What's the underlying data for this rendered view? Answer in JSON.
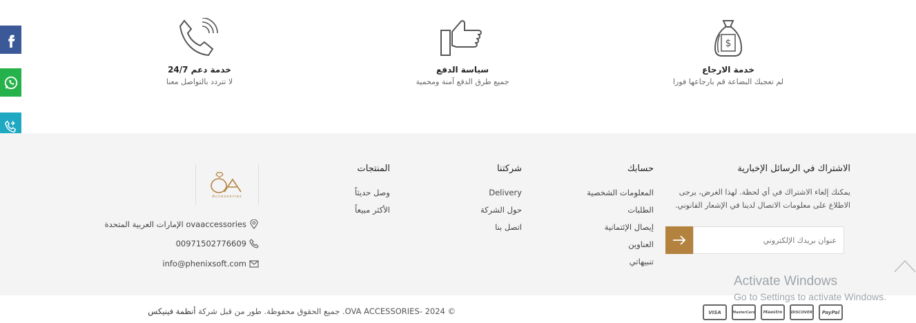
{
  "social": [
    {
      "name": "facebook",
      "icon": "facebook-icon",
      "color": "#3b5998"
    },
    {
      "name": "whatsapp",
      "icon": "whatsapp-icon",
      "color": "#25b24a"
    },
    {
      "name": "phone",
      "icon": "phone-icon",
      "color": "#1fa8c2"
    }
  ],
  "features": {
    "returns": {
      "title": "خدمة الارجاع",
      "subtitle": "لم تعجبك البضاعة قم بارجاعها فورا",
      "icon": "money-bag-icon"
    },
    "payment": {
      "title": "سياسة الدفع",
      "subtitle": "جميع طرق الدفع آمنة ومحمية",
      "icon": "thumbs-up-icon"
    },
    "support": {
      "title": "خدمة دعم 24/7",
      "subtitle": "لا تتردد بالتواصل معنا",
      "icon": "phone-call-icon"
    }
  },
  "newsletter": {
    "title": "الاشتراك في الرسائل الإخبارية",
    "text": "يمكنك إلغاء الاشتراك في أي لحظة. لهذا الغرض، يرجى الاطلاع على معلومات الاتصال لدينا في الإشعار القانوني.",
    "placeholder": "عنوان بريدك الإلكتروني"
  },
  "account": {
    "title": "حسابك",
    "links": [
      "المعلومات الشخصية",
      "الطلبات",
      "إيصال الإئتمانية",
      "العناوين",
      "تنبيهاتي"
    ]
  },
  "company": {
    "title": "شركتنا",
    "links": [
      "Delivery",
      "حول الشركة",
      "اتصل بنا"
    ]
  },
  "products": {
    "title": "المنتجات",
    "links": [
      "وصل حديثاً",
      "الأكثر مبيعاً"
    ]
  },
  "brand": {
    "logo_text": "OVA",
    "logo_sub": "Accessories"
  },
  "contact": {
    "address": "ovaaccessories الإمارات العربية المتحدة",
    "phone": "00971502776609",
    "email": "info@phenixsoft.com"
  },
  "copyright": {
    "text": "© 2024 -OVA ACCESSORIES. جميع الحقوق محفوظة. طور من قبل شركة",
    "company": "أنظمة فينيكس"
  },
  "payments": [
    "VISA",
    "MasterCard",
    "Maestro",
    "DISCOVER",
    "PayPal"
  ],
  "windows": {
    "line1": "Activate Windows",
    "line2": "Go to Settings to activate Windows."
  },
  "colors": {
    "accent": "#b3823e",
    "footer_bg": "#f4f4f4"
  }
}
